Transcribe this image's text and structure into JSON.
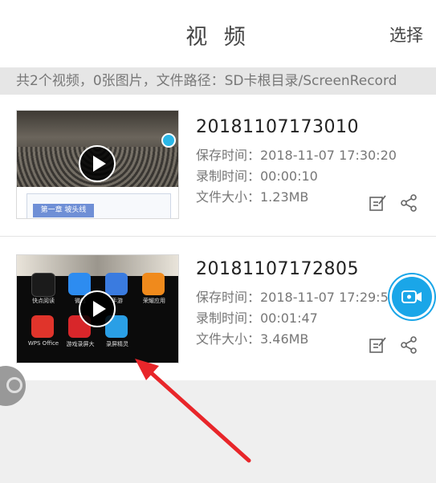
{
  "header": {
    "title": "视 频",
    "select_label": "选择"
  },
  "info_bar": {
    "text": "共2个视频，0张图片，文件路径：SD卡根目录/ScreenRecord"
  },
  "videos": [
    {
      "name": "20181107173010",
      "saved": "保存时间：2018-11-07 17:30:20",
      "duration": "录制时间：00:00:10",
      "size": "文件大小：1.23MB",
      "thumb_tag": "第一章 坡头线"
    },
    {
      "name": "20181107172805",
      "saved": "保存时间：2018-11-07 17:29:52",
      "duration": "录制时间：00:01:47",
      "size": "文件大小：3.46MB",
      "thumb_apps": [
        "快点阅读",
        "微信",
        "手游",
        "荣耀应用",
        "WPS Office",
        "游戏录屏大",
        "录屏精灵"
      ]
    }
  ],
  "colors": {
    "accent": "#1aa6e8",
    "arrow": "#e8262a",
    "tag": "#6f8fd6"
  },
  "icons": {
    "edit": "edit-icon",
    "share": "share-icon",
    "record": "camera-icon",
    "floating": "floating-ball-icon"
  }
}
